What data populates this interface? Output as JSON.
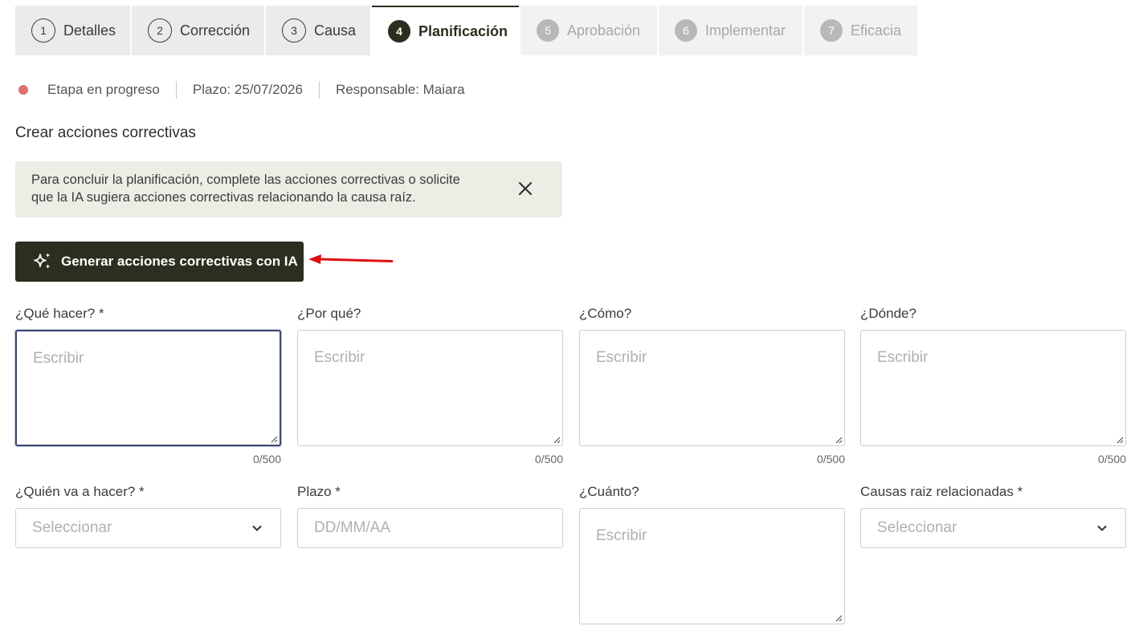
{
  "steps": [
    {
      "num": "1",
      "label": "Detalles"
    },
    {
      "num": "2",
      "label": "Corrección"
    },
    {
      "num": "3",
      "label": "Causa"
    },
    {
      "num": "4",
      "label": "Planificación"
    },
    {
      "num": "5",
      "label": "Aprobación"
    },
    {
      "num": "6",
      "label": "Implementar"
    },
    {
      "num": "7",
      "label": "Eficacia"
    }
  ],
  "status": {
    "state": "Etapa en progreso",
    "deadline": "Plazo: 25/07/2026",
    "owner": "Responsable: Maiara",
    "dot_color": "#e07070"
  },
  "section_title": "Crear acciones correctivas",
  "info": {
    "line1": "Para concluir la planificación, complete las acciones correctivas o solicite",
    "line2": "que la IA sugiera acciones correctivas relacionando la causa raíz."
  },
  "ai_button": {
    "label": "Generar acciones correctivas con IA",
    "icon": "sparkles-icon"
  },
  "fields": {
    "que": {
      "label": "¿Qué hacer? *",
      "placeholder": "Escribir",
      "counter": "0/500"
    },
    "porque": {
      "label": "¿Por qué?",
      "placeholder": "Escribir",
      "counter": "0/500"
    },
    "como": {
      "label": "¿Cómo?",
      "placeholder": "Escribir",
      "counter": "0/500"
    },
    "donde": {
      "label": "¿Dónde?",
      "placeholder": "Escribir",
      "counter": "0/500"
    },
    "quien": {
      "label": "¿Quién va a hacer? *",
      "placeholder": "Seleccionar"
    },
    "plazo": {
      "label": "Plazo *",
      "placeholder": "DD/MM/AA"
    },
    "cuanto": {
      "label": "¿Cuánto?",
      "placeholder": "Escribir"
    },
    "causas": {
      "label": "Causas raiz relacionadas *",
      "placeholder": "Seleccionar"
    }
  },
  "colors": {
    "primary": "#2d2d20",
    "annotation_arrow": "#e01010"
  }
}
